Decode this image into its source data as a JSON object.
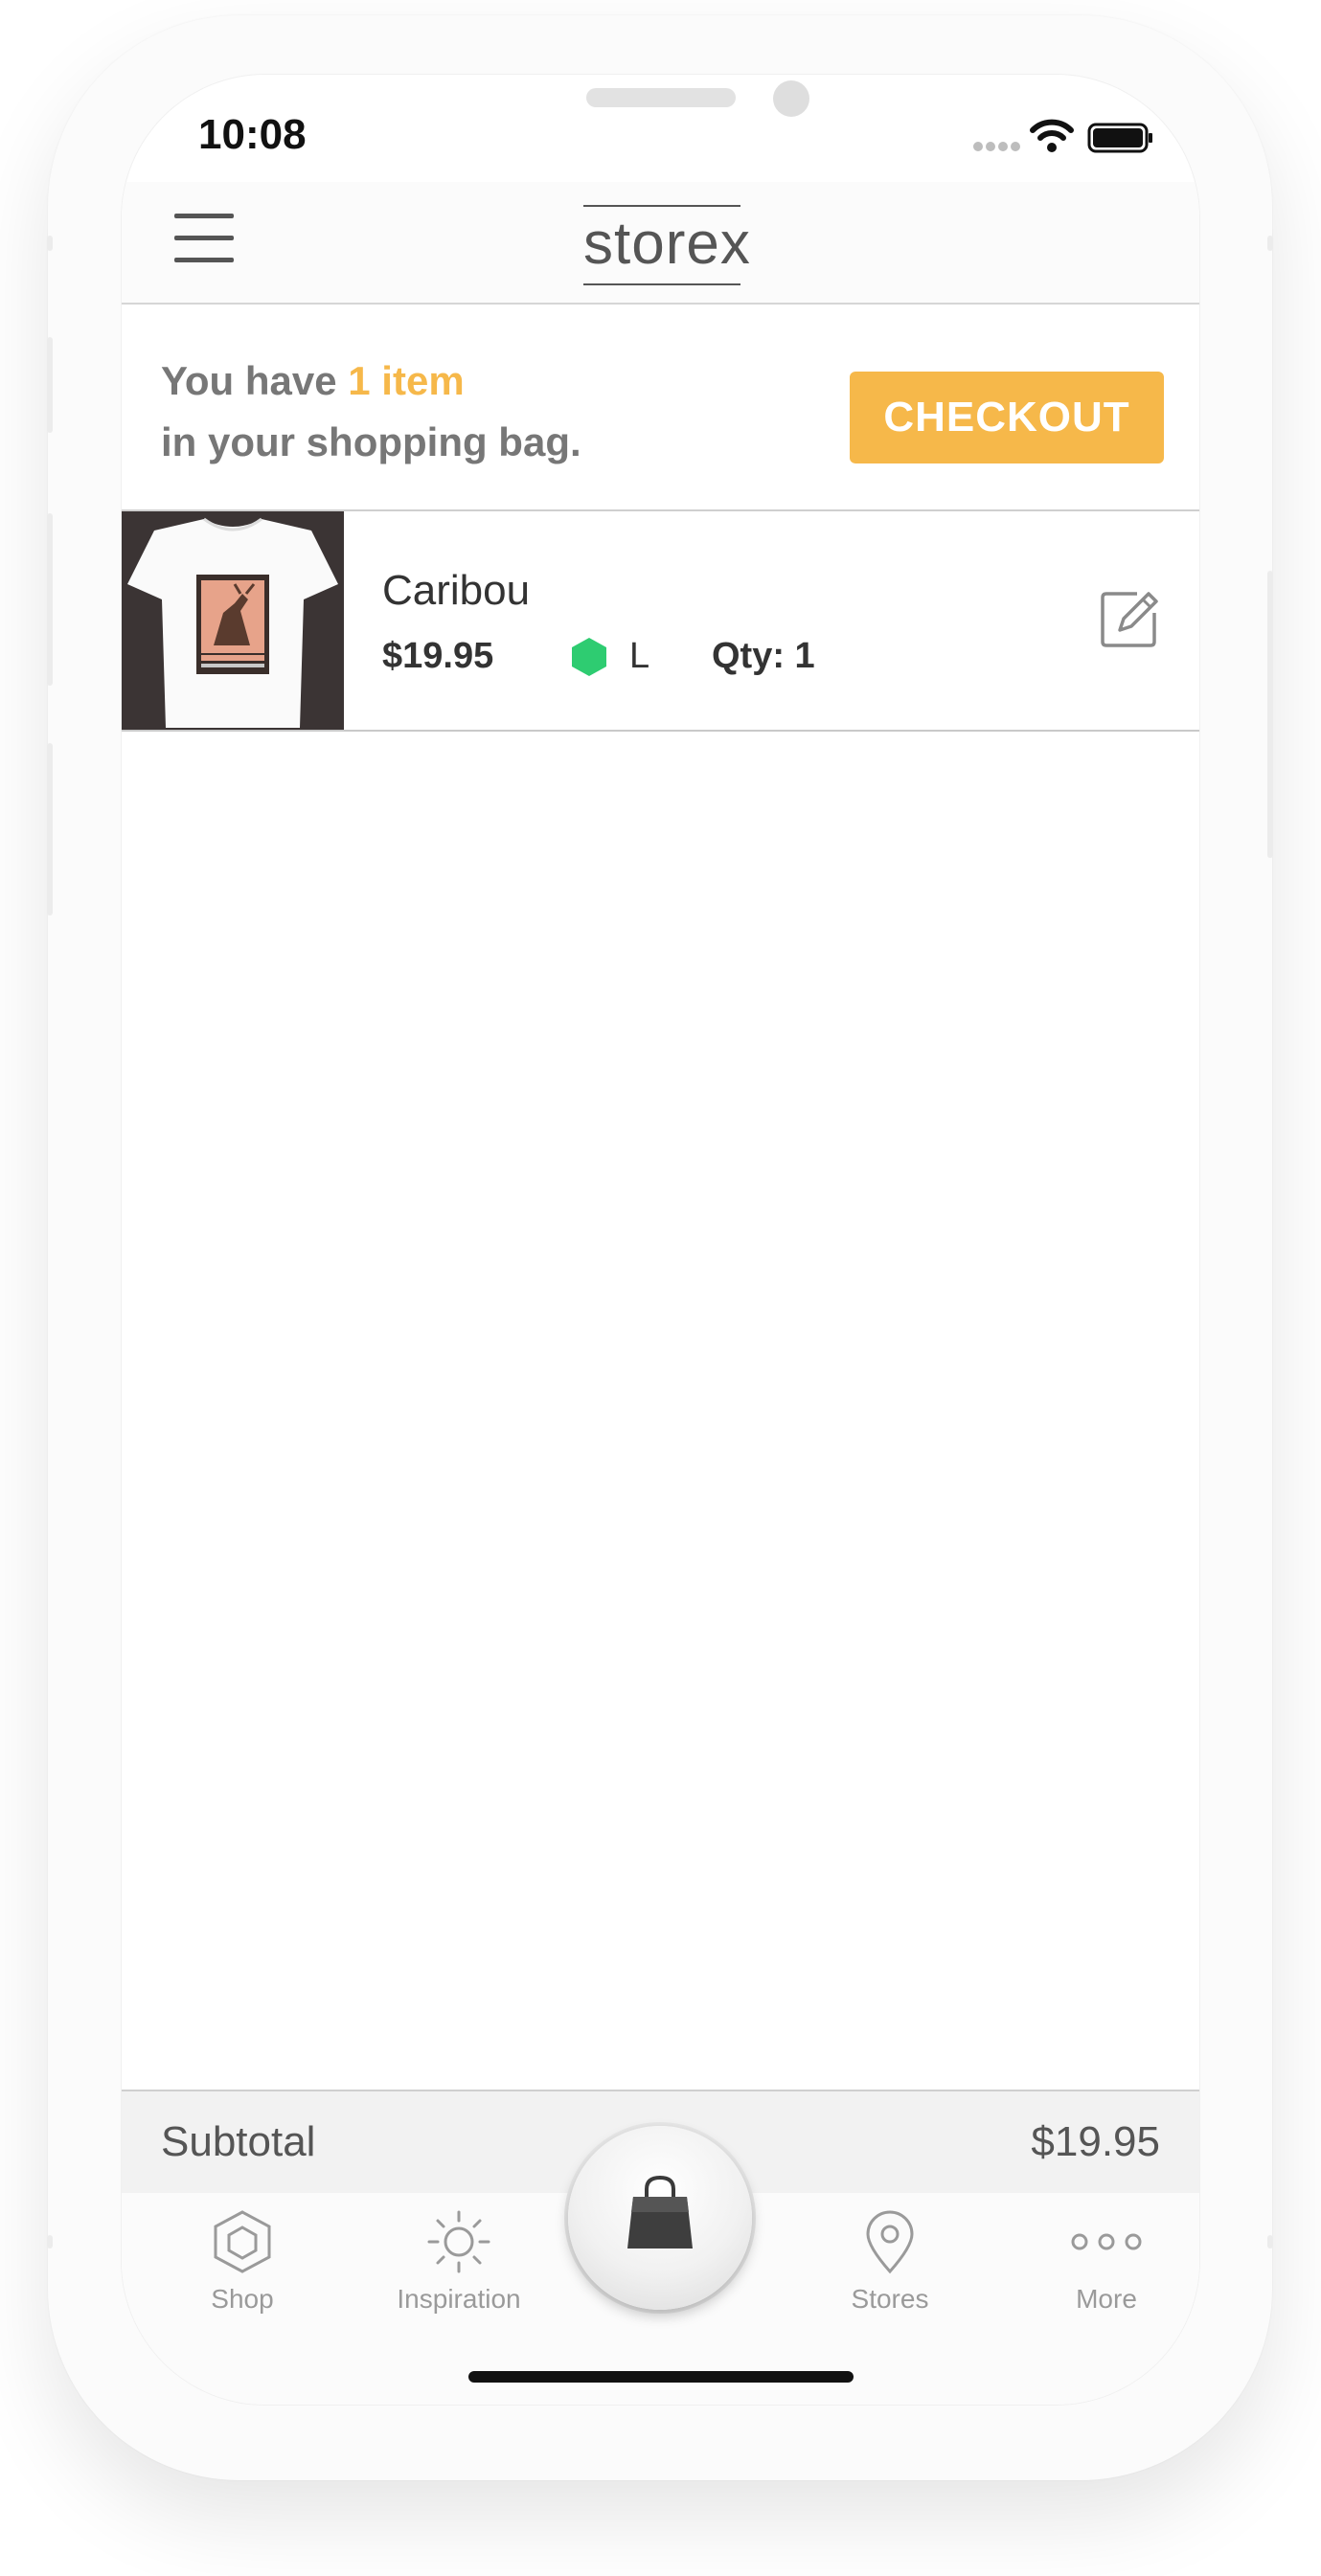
{
  "status_bar": {
    "time": "10:08"
  },
  "nav": {
    "logo": "storex"
  },
  "banner": {
    "prefix": "You have ",
    "highlight": "1 item",
    "suffix": "in your shopping bag.",
    "checkout_label": "CHECKOUT"
  },
  "cart": {
    "items": [
      {
        "name": "Caribou",
        "price": "$19.95",
        "color": "#2ecc71",
        "size": "L",
        "qty": "Qty: 1"
      }
    ]
  },
  "summary": {
    "subtotal_label": "Subtotal",
    "subtotal_value": "$19.95"
  },
  "tabbar": {
    "shop": "Shop",
    "inspiration": "Inspiration",
    "stores": "Stores",
    "more": "More"
  },
  "colors": {
    "accent": "#f6b84a",
    "text": "#333333",
    "muted": "#9a9a9a"
  }
}
